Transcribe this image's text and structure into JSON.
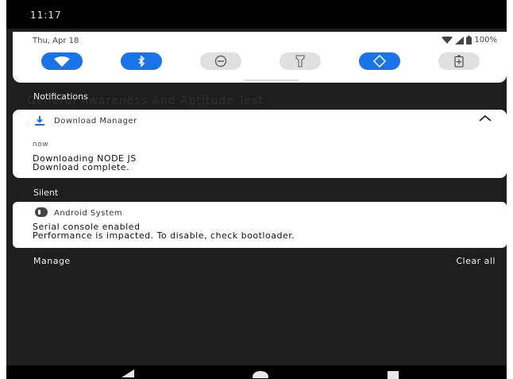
{
  "status_bar": {
    "time": "11:17"
  },
  "quick_settings": {
    "date": "Thu, Apr 18",
    "battery": "100%",
    "tiles": [
      {
        "icon": "wifi-icon",
        "active": true
      },
      {
        "icon": "bluetooth-icon",
        "active": true
      },
      {
        "icon": "do-not-disturb-icon",
        "active": false
      },
      {
        "icon": "flashlight-icon",
        "active": false
      },
      {
        "icon": "auto-rotate-icon",
        "active": true
      },
      {
        "icon": "battery-saver-icon",
        "active": false
      }
    ]
  },
  "background_title": "General Awareness And Aptitude Test",
  "sections": {
    "notifications": "Notifications",
    "silent": "Silent"
  },
  "download_notification": {
    "app": "Download Manager",
    "time": "now",
    "title": "Downloading NODE JS",
    "text": "Download complete."
  },
  "system_notification": {
    "app": "Android System",
    "title": "Serial console enabled",
    "text": "Performance is impacted. To disable, check bootloader."
  },
  "footer": {
    "manage": "Manage",
    "clear_all": "Clear all"
  },
  "colors": {
    "accent": "#1a73e8",
    "shade": "#1e1e1e",
    "card": "#ffffff"
  }
}
